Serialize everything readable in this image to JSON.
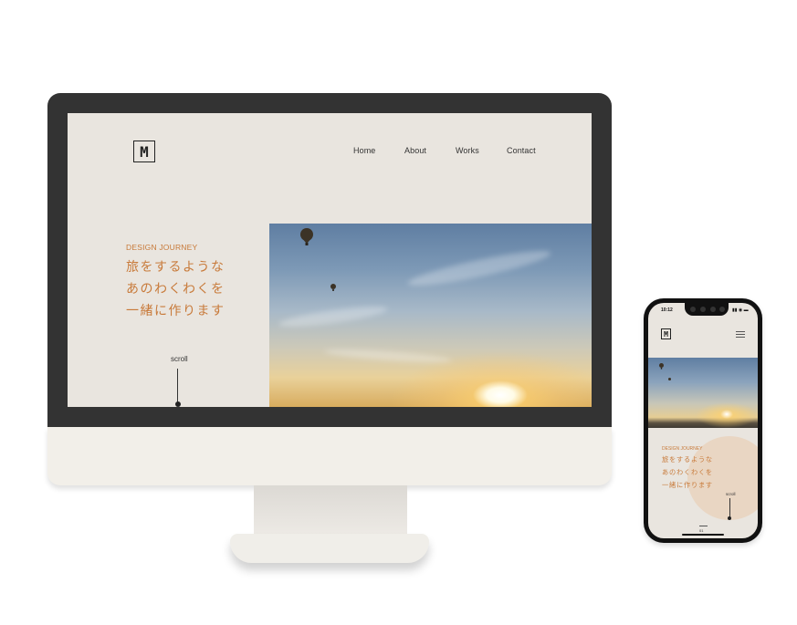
{
  "desktop": {
    "logo": "M",
    "nav": {
      "home": "Home",
      "about": "About",
      "works": "Works",
      "contact": "Contact"
    },
    "hero": {
      "subtitle": "DESIGN JOURNEY",
      "lines": [
        "旅をするような",
        "あのわくわくを",
        "一緒に作ります"
      ]
    },
    "scroll_label": "scroll"
  },
  "phone": {
    "status_time": "10:12",
    "status_icons": "▮▮ ◉ ▬",
    "logo": "M",
    "hero": {
      "subtitle": "DESIGN JOURNEY",
      "lines": [
        "旅をするような",
        "あのわくわくを",
        "一緒に作ります"
      ]
    },
    "scroll_label": "scroll",
    "page_number": "01"
  },
  "colors": {
    "accent": "#c87a3a",
    "page_background": "#e9e5df",
    "bezel": "#333333",
    "chin": "#f2efe9",
    "phone_circle": "#e9d6c3"
  },
  "icons": {
    "menu": "hamburger-icon",
    "balloon": "hot-air-balloon-icon"
  }
}
